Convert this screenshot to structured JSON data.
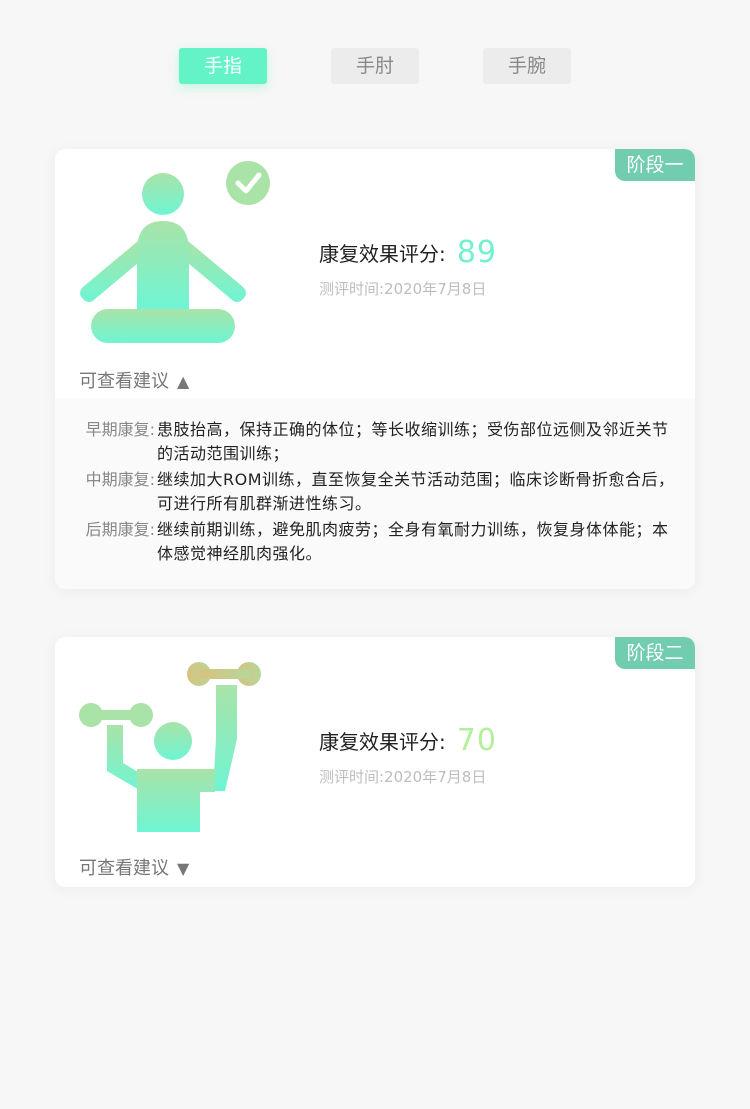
{
  "tabs": [
    {
      "label": "手指",
      "active": true
    },
    {
      "label": "手肘",
      "active": false
    },
    {
      "label": "手腕",
      "active": false
    }
  ],
  "stages": [
    {
      "badge": "阶段一",
      "score_label": "康复效果评分:",
      "score": "89",
      "test_time": "测评时间:2020年7月8日",
      "toggle_label": "可查看建议",
      "expanded": true,
      "advice": [
        {
          "label": "早期康复:",
          "text": "患肢抬高，保持正确的体位；等长收缩训练；受伤部位远侧及邻近关节的活动范围训练；"
        },
        {
          "label": "中期康复:",
          "text": "继续加大ROM训练，直至恢复全关节活动范围；临床诊断骨折愈合后，可进行所有肌群渐进性练习。"
        },
        {
          "label": "后期康复:",
          "text": "继续前期训练，避免肌肉疲劳；全身有氧耐力训练，恢复身体体能；本体感觉神经肌肉强化。"
        }
      ]
    },
    {
      "badge": "阶段二",
      "score_label": "康复效果评分:",
      "score": "70",
      "test_time": "测评时间:2020年7月8日",
      "toggle_label": "可查看建议",
      "expanded": false
    }
  ],
  "icons": {
    "stage1_figure": "meditation-figure-icon",
    "stage1_check": "check-circle-icon",
    "stage2_figure": "dumbbell-lifting-figure-icon",
    "expand_up": "triangle-up-icon",
    "expand_down": "triangle-down-icon"
  },
  "colors": {
    "accent": "#63f3c6",
    "badge": "#72cdb0",
    "score1": "#72f0cf",
    "score2": "#b4ef9a"
  }
}
